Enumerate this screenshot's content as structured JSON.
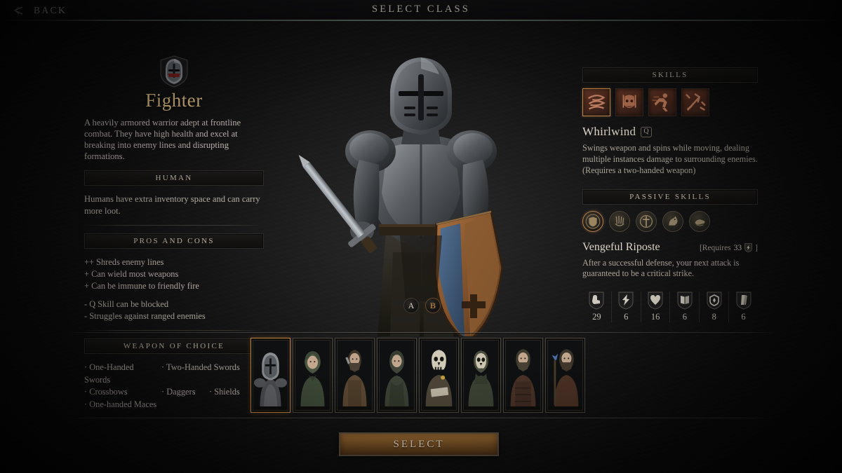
{
  "topbar": {
    "back_label": "BACK",
    "back_icon": "chevron-left-icon",
    "title": "SELECT CLASS"
  },
  "class": {
    "crest_icon": "knight-helm-shield-icon",
    "name": "Fighter",
    "description": "A heavily armored warrior adept at frontline combat. They have high health and excel at breaking into enemy lines and disrupting formations.",
    "race_header": "HUMAN",
    "race_description": "Humans have extra inventory space and can carry more loot.",
    "proscons_header": "PROS AND CONS",
    "pros": [
      "++ Shreds enemy lines",
      "+ Can wield most weapons",
      "+ Can be immune to friendly fire"
    ],
    "cons": [
      "- Q Skill can be blocked",
      "- Struggles against ranged enemies"
    ],
    "weapons_header": "WEAPON OF CHOICE",
    "weapons": [
      "· One-Handed Swords",
      "· Two-Handed Swords",
      "· Crossbows",
      "· Daggers",
      "· Shields",
      "· One-handed Maces"
    ]
  },
  "skills": {
    "header": "SKILLS",
    "icons": [
      {
        "name": "whirlwind-skill-icon",
        "selected": true
      },
      {
        "name": "rage-skill-icon",
        "selected": false
      },
      {
        "name": "sprint-skill-icon",
        "selected": false
      },
      {
        "name": "slam-skill-icon",
        "selected": false
      }
    ],
    "selected_name": "Whirlwind",
    "selected_key": "Q",
    "selected_description": "Swings weapon and spins while moving, dealing multiple instances damage to surrounding enemies. (Requires a two-handed weapon)"
  },
  "passives": {
    "header": "PASSIVE SKILLS",
    "icons": [
      {
        "name": "shield-passive-icon",
        "selected": true
      },
      {
        "name": "claw-passive-icon",
        "selected": false
      },
      {
        "name": "sword-cross-passive-icon",
        "selected": false
      },
      {
        "name": "horse-passive-icon",
        "selected": false
      },
      {
        "name": "fist-passive-icon",
        "selected": false
      }
    ],
    "selected_name": "Vengeful Riposte",
    "requires_prefix": "[Requires",
    "requires_value": "33",
    "requires_icon": "agility-shield-icon",
    "requires_suffix": "]",
    "selected_description": "After a successful defense, your next attack is guaranteed to be a critical strike."
  },
  "stats": [
    {
      "icon": "strength-stat-icon",
      "value": "29"
    },
    {
      "icon": "agility-stat-icon",
      "value": "6"
    },
    {
      "icon": "vitality-stat-icon",
      "value": "16"
    },
    {
      "icon": "knowledge-stat-icon",
      "value": "6"
    },
    {
      "icon": "resourcefulness-stat-icon",
      "value": "8"
    },
    {
      "icon": "will-stat-icon",
      "value": "6"
    }
  ],
  "pose_toggle": [
    {
      "label": "A",
      "active": false
    },
    {
      "label": "B",
      "active": true
    }
  ],
  "portraits": [
    {
      "name": "portrait-fighter",
      "selected": true,
      "hood": "#3a3a3c",
      "body": "#55565a",
      "skin": "#b9a08a"
    },
    {
      "name": "portrait-ranger",
      "selected": false,
      "hood": "#4a5242",
      "body": "#39412f",
      "skin": "#c3a78e"
    },
    {
      "name": "portrait-rogue",
      "selected": false,
      "hood": "#3b3228",
      "body": "#5a4732",
      "skin": "#bda188"
    },
    {
      "name": "portrait-druid",
      "selected": false,
      "hood": "#3e4438",
      "body": "#333a2e",
      "skin": "#c0a68d"
    },
    {
      "name": "portrait-warlock",
      "selected": false,
      "hood": "#2e2f2a",
      "body": "#4b4436",
      "skin": "#ccc6b4"
    },
    {
      "name": "portrait-cleric",
      "selected": false,
      "hood": "#4a4c3e",
      "body": "#3b3c31",
      "skin": "#cbc5b2"
    },
    {
      "name": "portrait-barbarian",
      "selected": false,
      "hood": "#3c3a2e",
      "body": "#4a3228",
      "skin": "#c1a68c"
    },
    {
      "name": "portrait-wizard",
      "selected": false,
      "hood": "#3a3329",
      "body": "#4e3326",
      "skin": "#c2a78d"
    }
  ],
  "footer": {
    "select_label": "SELECT"
  },
  "colors": {
    "accent_gold": "#d8b87c",
    "accent_orange": "#c2853f",
    "text_primary": "#c9c3b8",
    "panel_bg": "#141312"
  }
}
